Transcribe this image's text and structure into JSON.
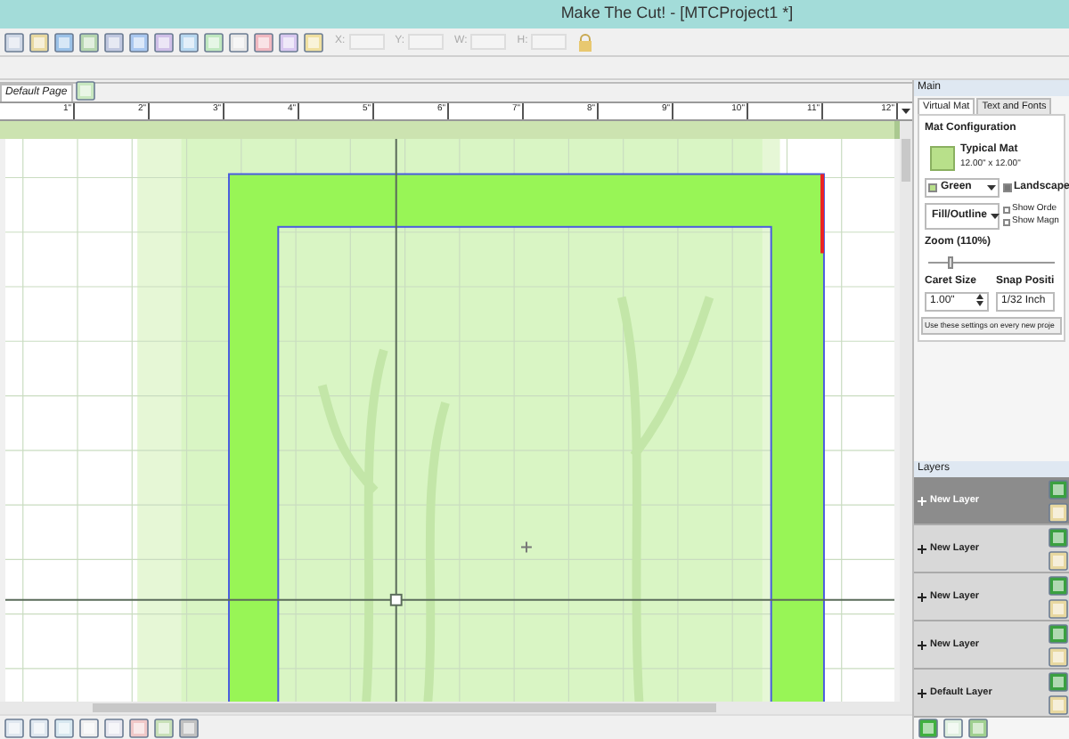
{
  "window": {
    "title": "Make The Cut! - [MTCProject1 *]"
  },
  "toolbar": {
    "fields": [
      {
        "label": "X:"
      },
      {
        "label": "Y:"
      },
      {
        "label": "W:"
      },
      {
        "label": "H:"
      }
    ]
  },
  "page_tabs": [
    {
      "label": "Default Page",
      "selected": true
    }
  ],
  "ruler": {
    "labels": [
      "1\"",
      "2\"",
      "3\"",
      "4\"",
      "5\"",
      "6\"",
      "7\"",
      "8\"",
      "9\"",
      "10\"",
      "11\"",
      "12\""
    ]
  },
  "panel": {
    "title": "Main",
    "tabs": [
      {
        "label": "Virtual Mat",
        "selected": true
      },
      {
        "label": "Text and Fonts",
        "selected": false
      }
    ],
    "mat_configuration": {
      "heading": "Mat Configuration",
      "mat_name": "Typical Mat",
      "mat_size": "12.00\" x 12.00\""
    },
    "color_dropdown": {
      "value": "Green"
    },
    "landscape": {
      "label": "Landscape",
      "checked": true
    },
    "fill_dropdown": {
      "value": "Fill/Outline"
    },
    "show_options": [
      {
        "label": "Show Orde",
        "checked": false
      },
      {
        "label": "Show Magn",
        "checked": false
      }
    ],
    "zoom": {
      "label": "Zoom (110%)",
      "level": 0.15
    },
    "caret_size": {
      "label": "Caret Size",
      "value": "1.00\""
    },
    "snap_position": {
      "label": "Snap Positi",
      "value": "1/32 Inch"
    },
    "apply_button": "Use these settings on every new proje"
  },
  "layers": {
    "title": "Layers",
    "items": [
      {
        "name": "New Layer",
        "selected": true
      },
      {
        "name": "New Layer",
        "selected": false
      },
      {
        "name": "New Layer",
        "selected": false
      },
      {
        "name": "New Layer",
        "selected": false
      },
      {
        "name": "Default Layer",
        "selected": false
      }
    ]
  }
}
